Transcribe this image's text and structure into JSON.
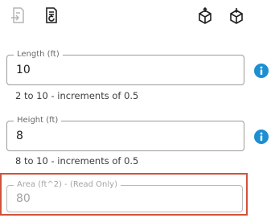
{
  "toolbar": {
    "icons": [
      {
        "name": "document-arrow-icon",
        "active": false
      },
      {
        "name": "document-refresh-icon",
        "active": true
      },
      {
        "name": "cube-upload-icon",
        "active": true
      },
      {
        "name": "cube-download-icon",
        "active": true
      }
    ]
  },
  "fields": {
    "length": {
      "label": "Length (ft)",
      "value": "10",
      "helper": "2 to 10 - increments of 0.5"
    },
    "height": {
      "label": "Height (ft)",
      "value": "8",
      "helper": "8 to 10 - increments of 0.5"
    },
    "area": {
      "label": "Area (ft^2) - (Read Only)",
      "value": "80"
    }
  },
  "colors": {
    "info": "#1d8fd1",
    "highlight": "#d2523a"
  }
}
